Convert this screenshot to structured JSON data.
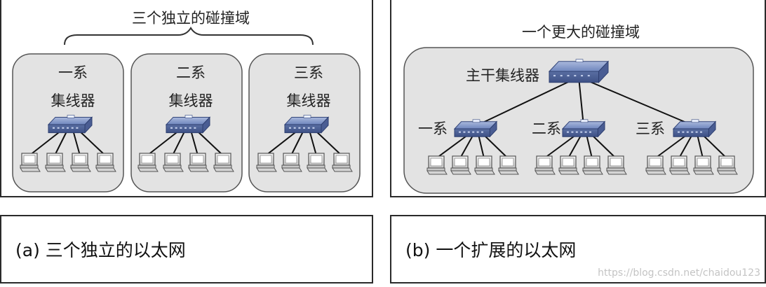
{
  "panel_a": {
    "title": "三个独立的碰撞域",
    "groups": [
      {
        "dept": "一系",
        "device": "集线器"
      },
      {
        "dept": "二系",
        "device": "集线器"
      },
      {
        "dept": "三系",
        "device": "集线器"
      }
    ],
    "caption": "(a) 三个独立的以太网"
  },
  "panel_b": {
    "title": "一个更大的碰撞域",
    "backbone": "主干集线器",
    "departments": [
      "一系",
      "二系",
      "三系"
    ],
    "caption": "(b) 一个扩展的以太网"
  },
  "watermark": "https://blog.csdn.net/chaidou123",
  "colors": {
    "domain_fill": "#e3e3e3",
    "domain_stroke": "#555555",
    "hub_blue": "#5d73a8",
    "link": "#111111"
  }
}
